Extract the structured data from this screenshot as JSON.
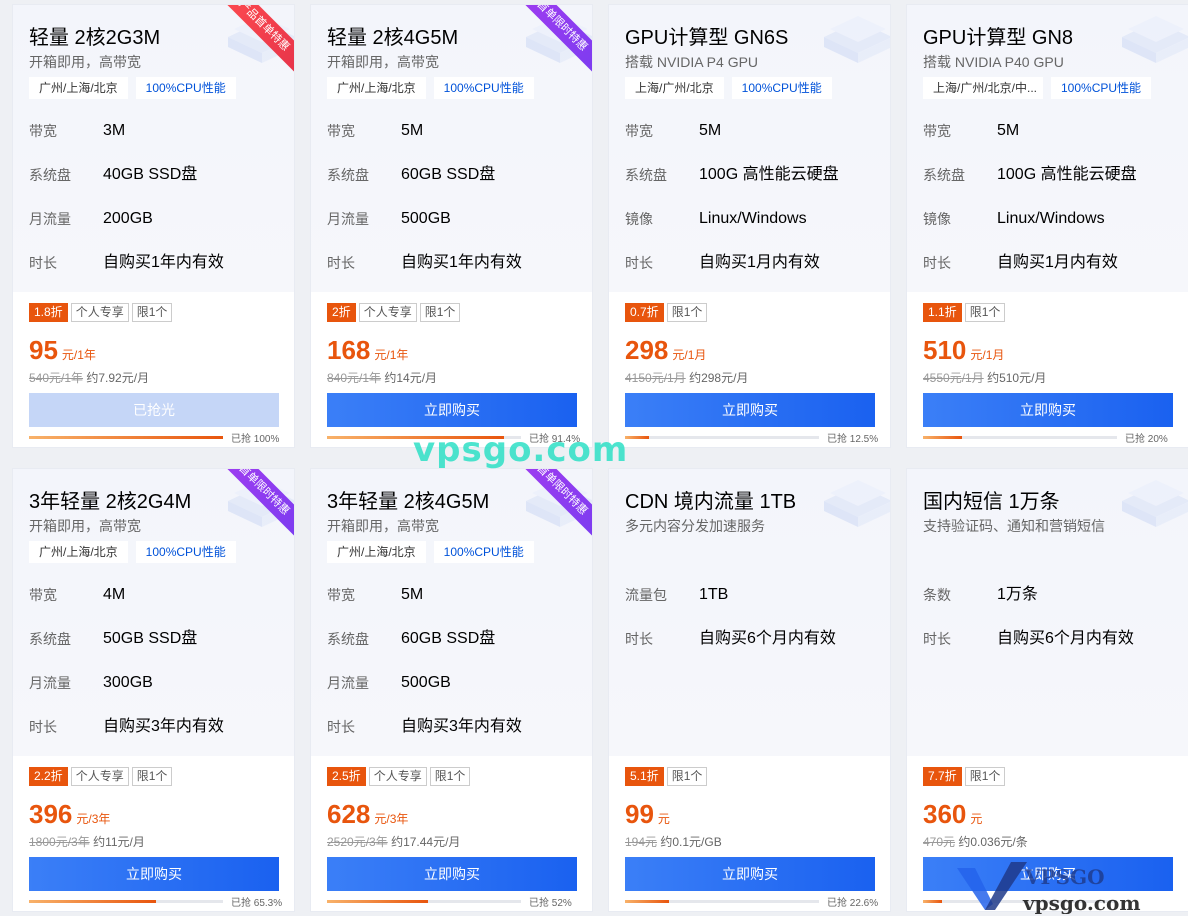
{
  "cards": [
    {
      "title": "轻量 2核2G3M",
      "subtitle": "开箱即用，高带宽",
      "ribbon": "产品首单特惠",
      "ribbon_color": "red",
      "tags": [
        "广州/上海/北京",
        "100%CPU性能"
      ],
      "specs": [
        {
          "label": "带宽",
          "value": "3M"
        },
        {
          "label": "系统盘",
          "value": "40GB SSD盘"
        },
        {
          "label": "月流量",
          "value": "200GB"
        },
        {
          "label": "时长",
          "value": "自购买1年内有效"
        }
      ],
      "discount": "1.8折",
      "badges": [
        "个人专享",
        "限1个"
      ],
      "price": "95",
      "unit": "元/1年",
      "orig_price": "540元/1年",
      "orig_note": "约7.92元/月",
      "button": "已抢光",
      "button_disabled": true,
      "progress_text": "已抢 100%",
      "progress": 1.0
    },
    {
      "title": "轻量 2核4G5M",
      "subtitle": "开箱即用，高带宽",
      "ribbon": "首单限时特惠",
      "ribbon_color": "purple",
      "tags": [
        "广州/上海/北京",
        "100%CPU性能"
      ],
      "specs": [
        {
          "label": "带宽",
          "value": "5M"
        },
        {
          "label": "系统盘",
          "value": "60GB SSD盘"
        },
        {
          "label": "月流量",
          "value": "500GB"
        },
        {
          "label": "时长",
          "value": "自购买1年内有效"
        }
      ],
      "discount": "2折",
      "badges": [
        "个人专享",
        "限1个"
      ],
      "price": "168",
      "unit": "元/1年",
      "orig_price": "840元/1年",
      "orig_note": "约14元/月",
      "button": "立即购买",
      "button_disabled": false,
      "progress_text": "已抢 91.4%",
      "progress": 0.914
    },
    {
      "title": "GPU计算型 GN6S",
      "subtitle": "搭载 NVIDIA P4 GPU",
      "ribbon": "",
      "ribbon_color": "",
      "tags": [
        "上海/广州/北京",
        "100%CPU性能"
      ],
      "specs": [
        {
          "label": "带宽",
          "value": "5M"
        },
        {
          "label": "系统盘",
          "value": "100G 高性能云硬盘"
        },
        {
          "label": "镜像",
          "value": "Linux/Windows"
        },
        {
          "label": "时长",
          "value": "自购买1月内有效"
        }
      ],
      "discount": "0.7折",
      "badges": [
        "限1个"
      ],
      "price": "298",
      "unit": "元/1月",
      "orig_price": "4150元/1月",
      "orig_note": "约298元/月",
      "button": "立即购买",
      "button_disabled": false,
      "progress_text": "已抢 12.5%",
      "progress": 0.125
    },
    {
      "title": "GPU计算型 GN8",
      "subtitle": "搭载 NVIDIA P40 GPU",
      "ribbon": "",
      "ribbon_color": "",
      "tags": [
        "上海/广州/北京/中...",
        "100%CPU性能"
      ],
      "specs": [
        {
          "label": "带宽",
          "value": "5M"
        },
        {
          "label": "系统盘",
          "value": "100G 高性能云硬盘"
        },
        {
          "label": "镜像",
          "value": "Linux/Windows"
        },
        {
          "label": "时长",
          "value": "自购买1月内有效"
        }
      ],
      "discount": "1.1折",
      "badges": [
        "限1个"
      ],
      "price": "510",
      "unit": "元/1月",
      "orig_price": "4550元/1月",
      "orig_note": "约510元/月",
      "button": "立即购买",
      "button_disabled": false,
      "progress_text": "已抢 20%",
      "progress": 0.2
    },
    {
      "title": "3年轻量 2核2G4M",
      "subtitle": "开箱即用，高带宽",
      "ribbon": "首单限时特惠",
      "ribbon_color": "purple",
      "tags": [
        "广州/上海/北京",
        "100%CPU性能"
      ],
      "specs": [
        {
          "label": "带宽",
          "value": "4M"
        },
        {
          "label": "系统盘",
          "value": "50GB SSD盘"
        },
        {
          "label": "月流量",
          "value": "300GB"
        },
        {
          "label": "时长",
          "value": "自购买3年内有效"
        }
      ],
      "discount": "2.2折",
      "badges": [
        "个人专享",
        "限1个"
      ],
      "price": "396",
      "unit": "元/3年",
      "orig_price": "1800元/3年",
      "orig_note": "约11元/月",
      "button": "立即购买",
      "button_disabled": false,
      "progress_text": "已抢 65.3%",
      "progress": 0.653
    },
    {
      "title": "3年轻量 2核4G5M",
      "subtitle": "开箱即用，高带宽",
      "ribbon": "首单限时特惠",
      "ribbon_color": "purple",
      "tags": [
        "广州/上海/北京",
        "100%CPU性能"
      ],
      "specs": [
        {
          "label": "带宽",
          "value": "5M"
        },
        {
          "label": "系统盘",
          "value": "60GB SSD盘"
        },
        {
          "label": "月流量",
          "value": "500GB"
        },
        {
          "label": "时长",
          "value": "自购买3年内有效"
        }
      ],
      "discount": "2.5折",
      "badges": [
        "个人专享",
        "限1个"
      ],
      "price": "628",
      "unit": "元/3年",
      "orig_price": "2520元/3年",
      "orig_note": "约17.44元/月",
      "button": "立即购买",
      "button_disabled": false,
      "progress_text": "已抢 52%",
      "progress": 0.52
    },
    {
      "title": "CDN 境内流量 1TB",
      "subtitle": "多元内容分发加速服务",
      "ribbon": "",
      "ribbon_color": "",
      "tags": [],
      "specs": [
        {
          "label": "流量包",
          "value": "1TB"
        },
        {
          "label": "时长",
          "value": "自购买6个月内有效"
        }
      ],
      "discount": "5.1折",
      "badges": [
        "限1个"
      ],
      "price": "99",
      "unit": "元",
      "orig_price": "194元",
      "orig_note": "约0.1元/GB",
      "button": "立即购买",
      "button_disabled": false,
      "progress_text": "已抢 22.6%",
      "progress": 0.226
    },
    {
      "title": "国内短信 1万条",
      "subtitle": "支持验证码、通知和营销短信",
      "ribbon": "",
      "ribbon_color": "",
      "tags": [],
      "specs": [
        {
          "label": "条数",
          "value": "1万条"
        },
        {
          "label": "时长",
          "value": "自购买6个月内有效"
        }
      ],
      "discount": "7.7折",
      "badges": [
        "限1个"
      ],
      "price": "360",
      "unit": "元",
      "orig_price": "470元",
      "orig_note": "约0.036元/条",
      "button": "立即购买",
      "button_disabled": false,
      "progress_text": "",
      "progress": 0.1
    }
  ],
  "watermark": "vpsgo.com",
  "logo_watermark": {
    "brand": "VPSGO",
    "url": "vpsgo.com"
  },
  "colors": {
    "accent": "#1a61f0",
    "price": "#e8550d",
    "discount_bg": "#e8550d"
  }
}
